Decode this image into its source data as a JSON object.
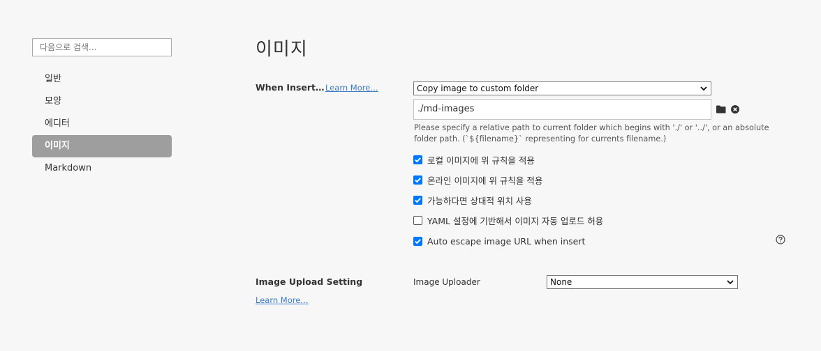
{
  "search": {
    "placeholder": "다음으로 검색..."
  },
  "sidebar": {
    "items": [
      {
        "label": "일반",
        "active": false
      },
      {
        "label": "모양",
        "active": false
      },
      {
        "label": "에디터",
        "active": false
      },
      {
        "label": "이미지",
        "active": true
      },
      {
        "label": "Markdown",
        "active": false
      }
    ]
  },
  "page": {
    "title": "이미지"
  },
  "when_insert": {
    "label": "When Insert…",
    "learn_more": "Learn More…",
    "action_select": "Copy image to custom folder",
    "path_value": "./md-images",
    "hint": " Please specify a relative path to current folder which begins with './' or '../', or an absolute folder path. (`${filename}` representing for currents filename.)",
    "options": [
      {
        "label": "로컬 이미지에 위 규칙을 적용",
        "checked": true
      },
      {
        "label": "온라인 이미지에 위 규칙을 적용",
        "checked": true
      },
      {
        "label": "가능하다면 상대적 위치 사용",
        "checked": true
      },
      {
        "label": "YAML 설정에 기반해서 이미지 자동 업로드 허용",
        "checked": false
      },
      {
        "label": "Auto escape image URL when insert",
        "checked": true
      }
    ]
  },
  "image_upload": {
    "label": "Image Upload Setting",
    "learn_more": "Learn More…",
    "uploader_label": "Image Uploader",
    "uploader_select": "None"
  },
  "colors": {
    "accent": "#0075ff",
    "active_nav": "#9e9e9e",
    "link": "#3a7bc8"
  },
  "icons": [
    "folder-icon",
    "clear-icon",
    "help-icon",
    "chevron-down-icon",
    "checkmark-icon"
  ]
}
